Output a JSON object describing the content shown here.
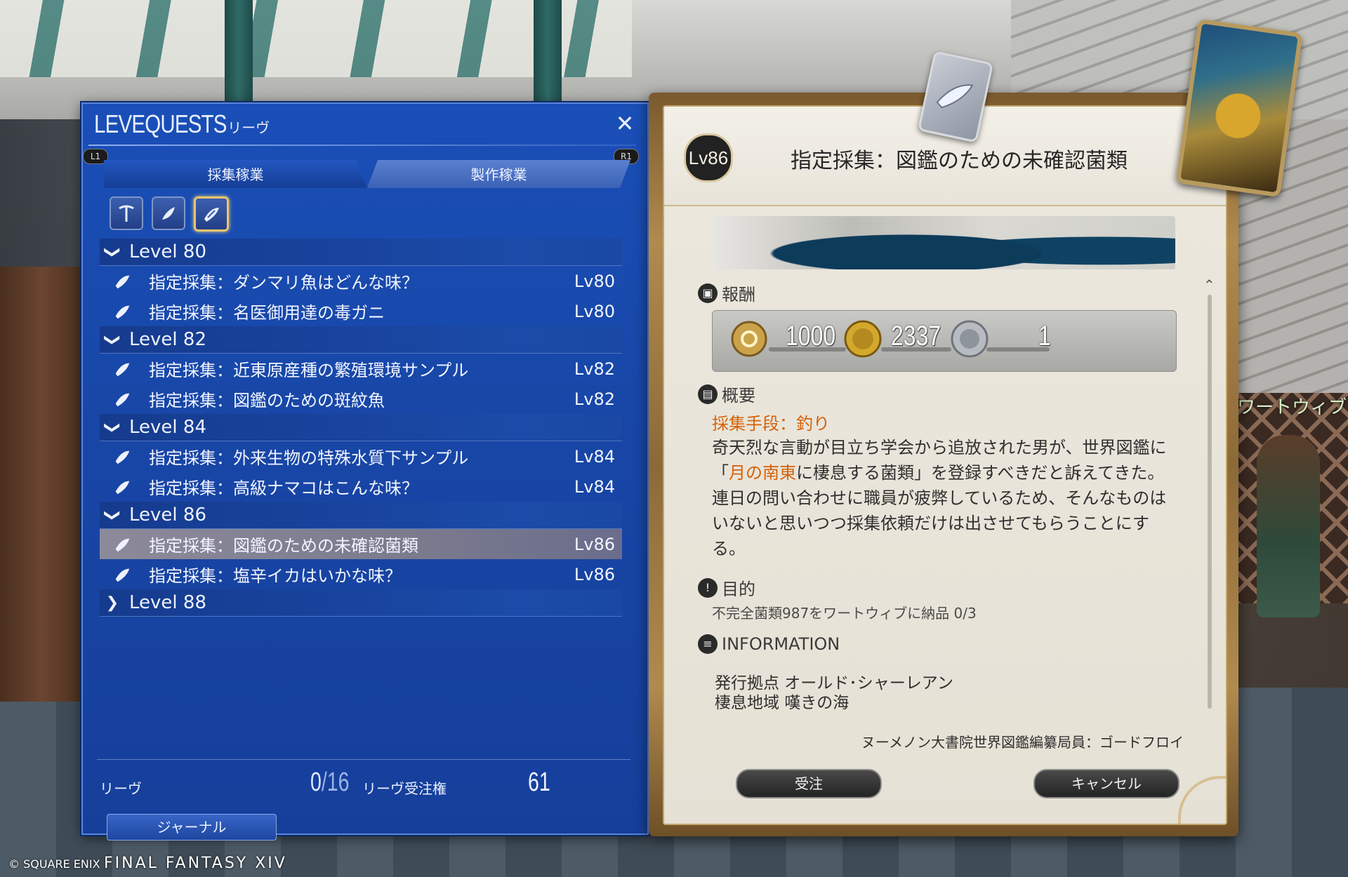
{
  "window": {
    "title": "LEVEQUESTS",
    "subtitle": "リーヴ",
    "close_glyph": "✕",
    "l1_label": "L1",
    "r1_label": "R1"
  },
  "tabs": [
    {
      "label": "採集稼業",
      "active": true
    },
    {
      "label": "製作稼業",
      "active": false
    }
  ],
  "filters": [
    {
      "icon": "pickaxe-icon",
      "selected": false
    },
    {
      "icon": "sickle-icon",
      "selected": false
    },
    {
      "icon": "fishing-icon",
      "selected": true
    }
  ],
  "groups": [
    {
      "label": "Level 80",
      "expanded": true,
      "quests": [
        {
          "name": "指定採集：ダンマリ魚はどんな味？",
          "level": "Lv80"
        },
        {
          "name": "指定採集：名医御用達の毒ガニ",
          "level": "Lv80"
        }
      ]
    },
    {
      "label": "Level 82",
      "expanded": true,
      "quests": [
        {
          "name": "指定採集：近東原産種の繁殖環境サンプル",
          "level": "Lv82"
        },
        {
          "name": "指定採集：図鑑のための斑紋魚",
          "level": "Lv82"
        }
      ]
    },
    {
      "label": "Level 84",
      "expanded": true,
      "quests": [
        {
          "name": "指定採集：外来生物の特殊水質下サンプル",
          "level": "Lv84"
        },
        {
          "name": "指定採集：高級ナマコはこんな味？",
          "level": "Lv84"
        }
      ]
    },
    {
      "label": "Level 86",
      "expanded": true,
      "quests": [
        {
          "name": "指定採集：図鑑のための未確認菌類",
          "level": "Lv86",
          "selected": true
        },
        {
          "name": "指定採集：塩辛イカはいかな味？",
          "level": "Lv86"
        }
      ]
    },
    {
      "label": "Level 88",
      "expanded": false,
      "quests": []
    }
  ],
  "footer": {
    "leves_label": "リーヴ",
    "leves_current": "0",
    "leves_max": "16",
    "allowances_label": "リーヴ受注権",
    "allowances": "61",
    "journal_label": "ジャーナル"
  },
  "detail": {
    "level_badge": "Lv86",
    "title": "指定採集：図鑑のための未確認菌類",
    "rewards_heading": "報酬",
    "rewards": [
      {
        "icon": "exp-icon",
        "value": "1000"
      },
      {
        "icon": "gil-icon",
        "value": "2337"
      },
      {
        "icon": "seal-icon",
        "value": "1"
      }
    ],
    "summary_heading": "概要",
    "method": "採集手段：釣り",
    "desc_line1": "奇天烈な言動が目立ち学会から追放された男が、世界図鑑に",
    "desc_line2_pre": "「",
    "desc_line2_hl": "月の南東",
    "desc_line2_post": "に棲息する菌類」を登録すべきだと訴えてきた。",
    "desc_line3": "連日の問い合わせに職員が疲弊しているため、そんなものは",
    "desc_line4": "いないと思いつつ採集依頼だけは出させてもらうことにす",
    "desc_line5": "る。",
    "objective_heading": "目的",
    "objective": "不完全菌類987をワートウィブに納品 0/3",
    "info_heading": "INFORMATION",
    "info_issued": "発行拠点 オールド･シャーレアン",
    "info_habitat": "棲息地域 嘆きの海",
    "issuer": "ヌーメノン大書院世界図鑑編纂局員：ゴードフロイ",
    "accept_label": "受注",
    "cancel_label": "キャンセル"
  },
  "scene": {
    "npc_name": "ワートウィブ",
    "copyright": "© SQUARE ENIX",
    "logo": "FINAL FANTASY XIV"
  }
}
